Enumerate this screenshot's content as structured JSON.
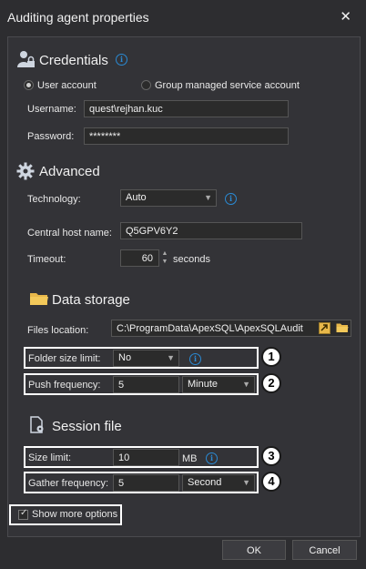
{
  "window": {
    "title": "Auditing agent properties",
    "close_glyph": "✕"
  },
  "credentials": {
    "heading": "Credentials",
    "icon": "user-lock-icon",
    "radio_user": "User account",
    "radio_gmsa": "Group managed service account",
    "username_label": "Username:",
    "username_value": "quest\\rejhan.kuc",
    "password_label": "Password:",
    "password_value": "********"
  },
  "advanced": {
    "heading": "Advanced",
    "icon": "gear-icon",
    "technology_label": "Technology:",
    "technology_value": "Auto",
    "host_label": "Central host name:",
    "host_value": "Q5GPV6Y2",
    "timeout_label": "Timeout:",
    "timeout_value": "60",
    "timeout_unit": "seconds"
  },
  "data_storage": {
    "heading": "Data storage",
    "icon": "folder-icon",
    "files_location_label": "Files location:",
    "files_location_value": "C:\\ProgramData\\ApexSQL\\ApexSQLAudit",
    "folder_limit_label": "Folder size limit:",
    "folder_limit_value": "No",
    "push_label": "Push frequency:",
    "push_value": "5",
    "push_unit": "Minute"
  },
  "session_file": {
    "heading": "Session file",
    "icon": "file-gear-icon",
    "size_label": "Size limit:",
    "size_value": "10",
    "size_unit": "MB",
    "gather_label": "Gather frequency:",
    "gather_value": "5",
    "gather_unit": "Second"
  },
  "show_more": "Show more options",
  "badges": [
    "1",
    "2",
    "3",
    "4"
  ],
  "buttons": {
    "ok": "OK",
    "cancel": "Cancel"
  },
  "colors": {
    "background": "#2d2d30",
    "panel": "#333337",
    "accent": "#2a8ad4",
    "highlight": "#ffffff"
  }
}
